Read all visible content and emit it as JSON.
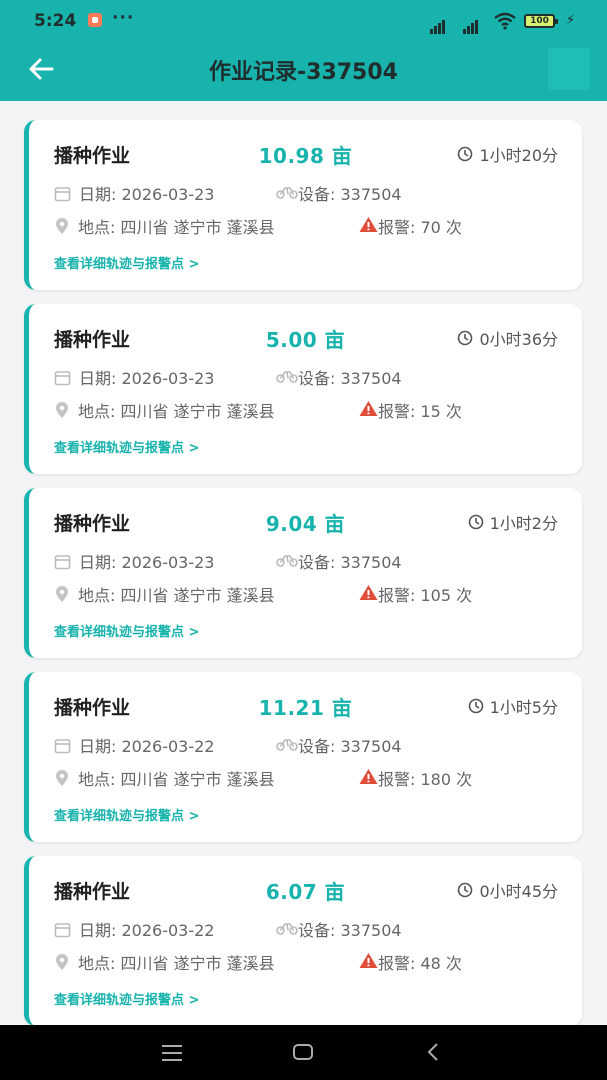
{
  "status_bar": {
    "time": "5:24",
    "more": "···",
    "battery": "100"
  },
  "header": {
    "title": "作业记录-337504"
  },
  "records": [
    {
      "type": "播种作业",
      "area": "10.98 亩",
      "duration": "1小时20分",
      "date": "日期: 2026-03-23",
      "device": "设备: 337504",
      "location": "地点: 四川省 遂宁市 蓬溪县",
      "alarms": "报警: 70 次",
      "link": "查看详细轨迹与报警点 >"
    },
    {
      "type": "播种作业",
      "area": "5.00 亩",
      "duration": "0小时36分",
      "date": "日期: 2026-03-23",
      "device": "设备: 337504",
      "location": "地点: 四川省 遂宁市 蓬溪县",
      "alarms": "报警: 15 次",
      "link": "查看详细轨迹与报警点 >"
    },
    {
      "type": "播种作业",
      "area": "9.04 亩",
      "duration": "1小时2分",
      "date": "日期: 2026-03-23",
      "device": "设备: 337504",
      "location": "地点: 四川省 遂宁市 蓬溪县",
      "alarms": "报警: 105 次",
      "link": "查看详细轨迹与报警点 >"
    },
    {
      "type": "播种作业",
      "area": "11.21 亩",
      "duration": "1小时5分",
      "date": "日期: 2026-03-22",
      "device": "设备: 337504",
      "location": "地点: 四川省 遂宁市 蓬溪县",
      "alarms": "报警: 180 次",
      "link": "查看详细轨迹与报警点 >"
    },
    {
      "type": "播种作业",
      "area": "6.07 亩",
      "duration": "0小时45分",
      "date": "日期: 2026-03-22",
      "device": "设备: 337504",
      "location": "地点: 四川省 遂宁市 蓬溪县",
      "alarms": "报警: 48 次",
      "link": "查看详细轨迹与报警点 >"
    }
  ],
  "icons": {
    "back": "back-arrow-icon",
    "duration": "clock-icon",
    "date": "calendar-icon",
    "device": "motorbike-icon",
    "location": "location-pin-icon",
    "alarm": "warning-triangle-icon"
  },
  "colors": {
    "primary": "#17b3ac",
    "alarm": "#e04b3a",
    "background": "#f3f4f6"
  }
}
